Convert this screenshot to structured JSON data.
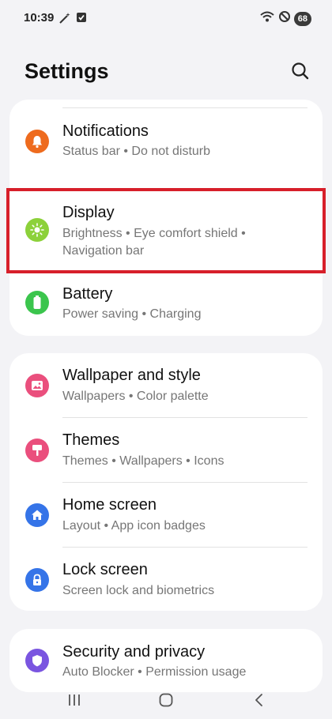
{
  "status_bar": {
    "time": "10:39",
    "battery": "68",
    "left_icons": [
      "wand-icon",
      "check-square-icon"
    ],
    "right_icons": [
      "wifi-icon",
      "do-not-disturb-icon"
    ]
  },
  "header": {
    "title": "Settings",
    "search_icon": "search-icon"
  },
  "groups": [
    {
      "items": [
        {
          "title": "Notifications",
          "sub": "Status bar  •  Do not disturb",
          "icon": "bell-icon",
          "color": "#ee6b1e"
        },
        {
          "title": "Display",
          "sub": "Brightness  •  Eye comfort shield  •",
          "sub2": "Navigation bar",
          "icon": "sun-icon",
          "color": "#8cd13a",
          "highlighted": true
        },
        {
          "title": "Battery",
          "sub": "Power saving  •  Charging",
          "icon": "battery-icon",
          "color": "#3bc54d"
        }
      ]
    },
    {
      "items": [
        {
          "title": "Wallpaper and style",
          "sub": "Wallpapers  •  Color palette",
          "icon": "image-icon",
          "color": "#ea4f7d"
        },
        {
          "title": "Themes",
          "sub": "Themes  •  Wallpapers  •  Icons",
          "icon": "brush-icon",
          "color": "#ea4f7d"
        },
        {
          "title": "Home screen",
          "sub": "Layout  •  App icon badges",
          "icon": "home-icon",
          "color": "#3574e8"
        },
        {
          "title": "Lock screen",
          "sub": "Screen lock and biometrics",
          "icon": "lock-icon",
          "color": "#3574e8"
        }
      ]
    },
    {
      "items": [
        {
          "title": "Security and privacy",
          "sub": "Auto Blocker  •  Permission usage",
          "icon": "shield-icon",
          "color": "#7a55e0"
        }
      ]
    }
  ],
  "nav_bar": {
    "buttons": [
      "recents-icon",
      "home-nav-icon",
      "back-icon"
    ]
  }
}
